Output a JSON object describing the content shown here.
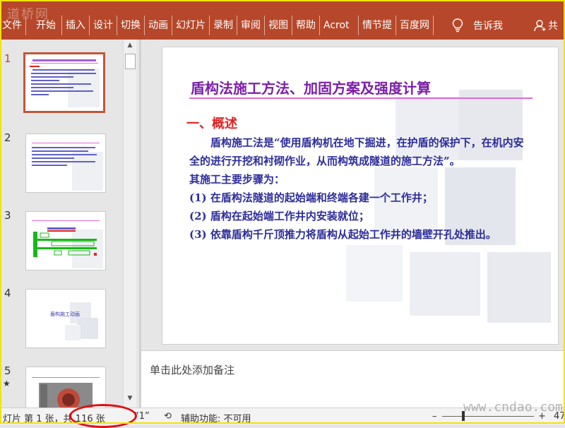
{
  "watermark": "道桥网",
  "ribbon": {
    "tabs": [
      "文件",
      "开始",
      "插入",
      "设计",
      "切换",
      "动画",
      "幻灯片",
      "录制",
      "审阅",
      "视图",
      "帮助",
      "Acrot",
      "情节提",
      "百度网"
    ],
    "tell_me": "告诉我",
    "share": "共"
  },
  "thumbnails": {
    "numbers": [
      "1",
      "2",
      "3",
      "4",
      "5"
    ],
    "star": "★",
    "slide4_caption": "盾构施工动画"
  },
  "slide": {
    "title": "盾构法施工方法、加固方案及强度计算",
    "section": "一、概述",
    "paragraphs": [
      "盾构施工法是“使用盾构机在地下掘进，在护盾的保护下，在机内安全的进行开挖和衬砌作业，从而构筑成隧道的施工方法”。",
      "其施工主要步骤为：",
      "(1) 在盾构法隧道的起始端和终端各建一个工作井；",
      "(2) 盾构在起始端工作井内安装就位；",
      "(3) 依靠盾构千斤顶推力将盾构从起始工作井的墙壁开孔处推出。"
    ]
  },
  "notes": {
    "placeholder": "单击此处添加备注"
  },
  "status": {
    "slide_info": "灯片 第 1 张，共 116 张",
    "lang": "“1”",
    "accessibility": "辅助功能: 不可用",
    "zoom_minus": "–",
    "zoom_plus": "+",
    "zoom_value": "47",
    "site": "www.cndao.com"
  },
  "colors": {
    "ribbon": "#b7472a",
    "title": "#7a1fa8",
    "section": "#e02020",
    "body": "#2d2d9b",
    "highlight": "#e01010"
  }
}
